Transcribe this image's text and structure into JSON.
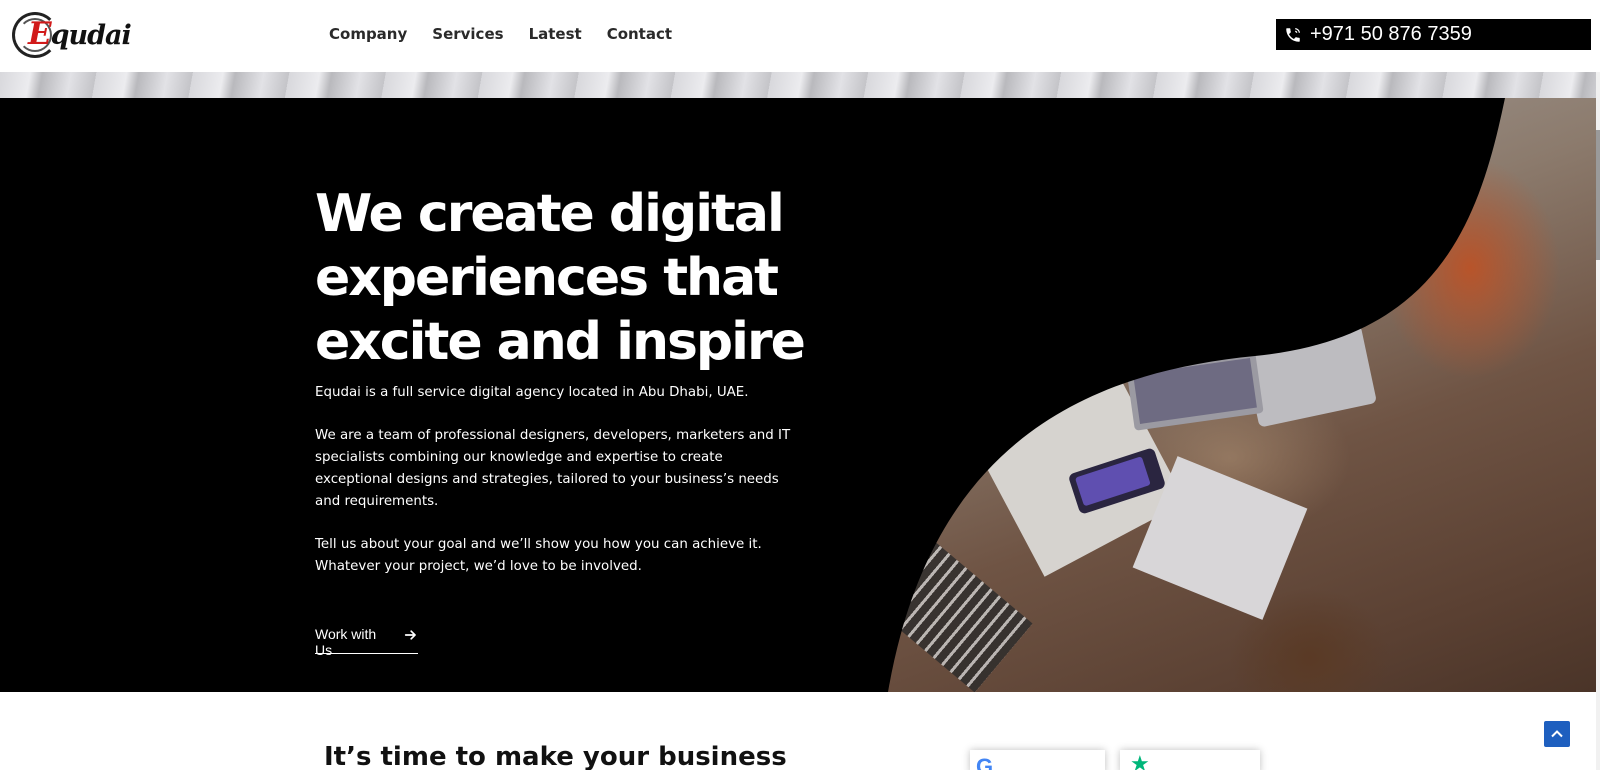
{
  "brand": {
    "logo_text_e": "E",
    "logo_text_rest": "qudai"
  },
  "nav": {
    "items": [
      {
        "label": "Company"
      },
      {
        "label": "Services"
      },
      {
        "label": "Latest"
      },
      {
        "label": "Contact"
      }
    ]
  },
  "header": {
    "phone": "+971 50 876 7359",
    "phone_icon": "phone-icon"
  },
  "hero": {
    "title_line1": "We create digital",
    "title_line2": "experiences that",
    "title_line3": "excite and inspire",
    "paragraph1": "Equdai is a full service digital agency located in Abu Dhabi, UAE.",
    "paragraph2": "We are a team of professional designers, developers, marketers and IT specialists combining our knowledge and expertise to create exceptional designs and strategies, tailored to your business’s needs and requirements.",
    "paragraph3": "Tell us about your goal and we’ll show you how you can achieve it. Whatever your project, we’d love to be involved.",
    "cta_label": "Work with Us",
    "cta_icon": "arrow-right-icon"
  },
  "below": {
    "title": "It’s time to make your business"
  },
  "colors": {
    "hero_bg": "#000000",
    "text_on_dark": "#ffffff",
    "brand_red": "#d11a1a",
    "back_to_top": "#1e5fbf"
  }
}
